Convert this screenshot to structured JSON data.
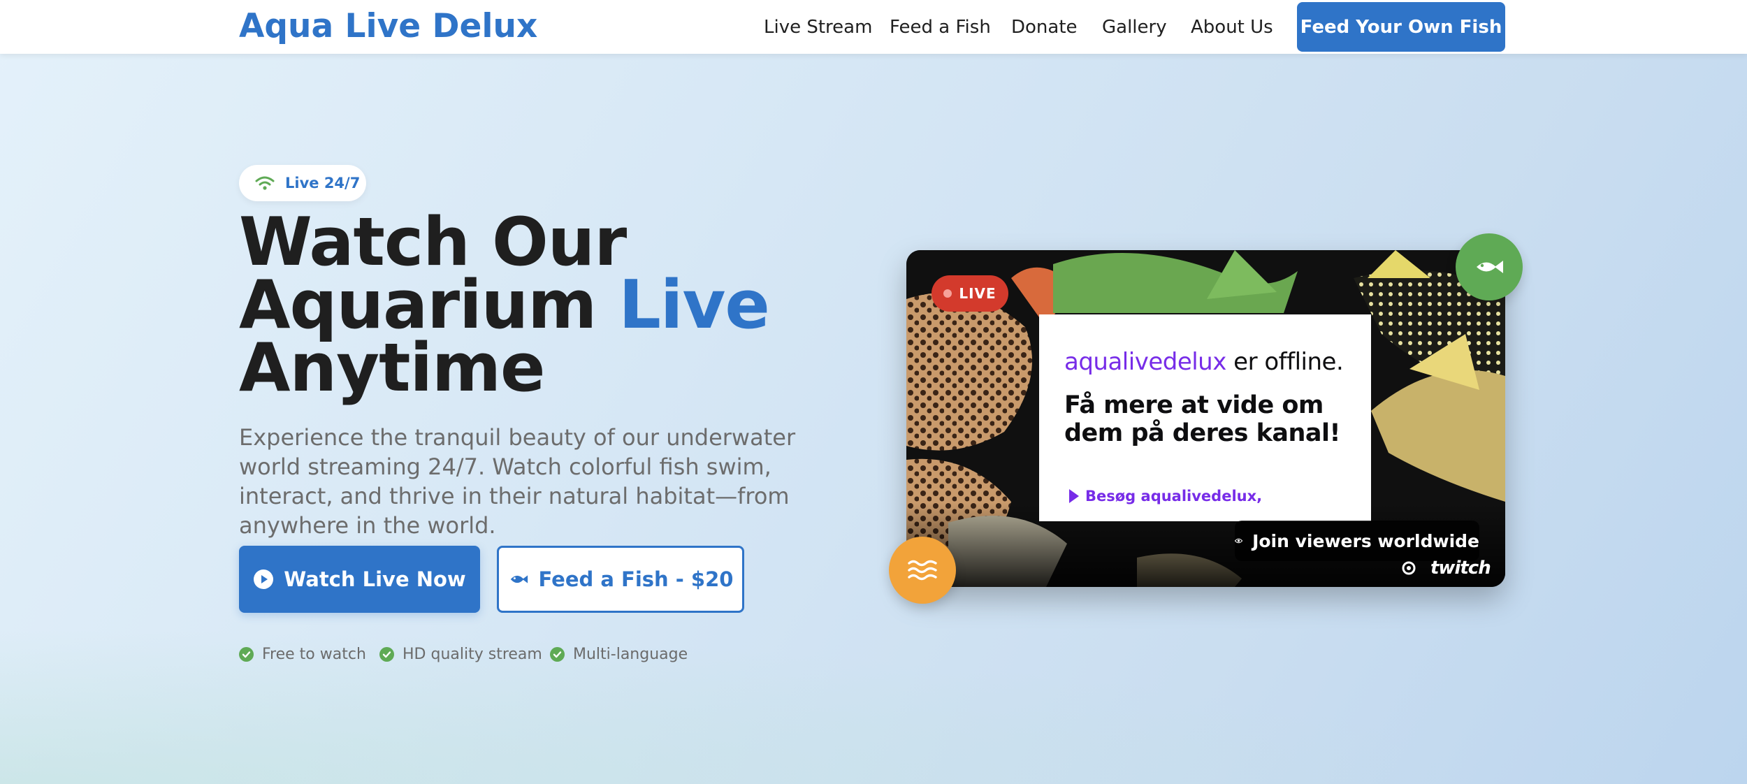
{
  "brand": {
    "name": "Aqua Live Delux",
    "color": "#2f74c8"
  },
  "nav": {
    "items": [
      {
        "label": "Live Stream"
      },
      {
        "label": "Feed a Fish"
      },
      {
        "label": "Donate"
      },
      {
        "label": "Gallery"
      },
      {
        "label": "About Us"
      }
    ],
    "cta_label": "Feed Your Own Fish"
  },
  "hero": {
    "badge": {
      "icon": "wifi-icon",
      "label": "Live 24/7"
    },
    "headline": {
      "line1": "Watch Our",
      "line2_a": "Aquarium ",
      "line2_accent": "Live",
      "line3": "Anytime"
    },
    "subtitle": "Experience the tranquil beauty of our underwater world streaming 24/7. Watch colorful fish swim, interact, and thrive in their natural habitat—from anywhere in the world.",
    "primary_button": {
      "icon": "play-circle-icon",
      "label": "Watch Live Now"
    },
    "secondary_button": {
      "icon": "fish-icon",
      "label": "Feed a Fish - $20"
    },
    "features": [
      {
        "icon": "check-circle-icon",
        "label": "Free to watch"
      },
      {
        "icon": "check-circle-icon",
        "label": "HD quality stream"
      },
      {
        "icon": "check-circle-icon",
        "label": "Multi-language"
      }
    ]
  },
  "video": {
    "live_label": "LIVE",
    "offline": {
      "channel": "aqualivedelux",
      "status": " er offline.",
      "message": "Få mere at vide om dem på deres kanal!",
      "link": "Besøg aqualivedelux,"
    },
    "viewers_label": "Join viewers worldwide",
    "platform": "twitch"
  },
  "colors": {
    "accent": "#2f74c8",
    "live_red": "#d33a2c",
    "success_green": "#5faa55",
    "warning_orange": "#f2a33a",
    "twitch_purple": "#772ce8"
  }
}
